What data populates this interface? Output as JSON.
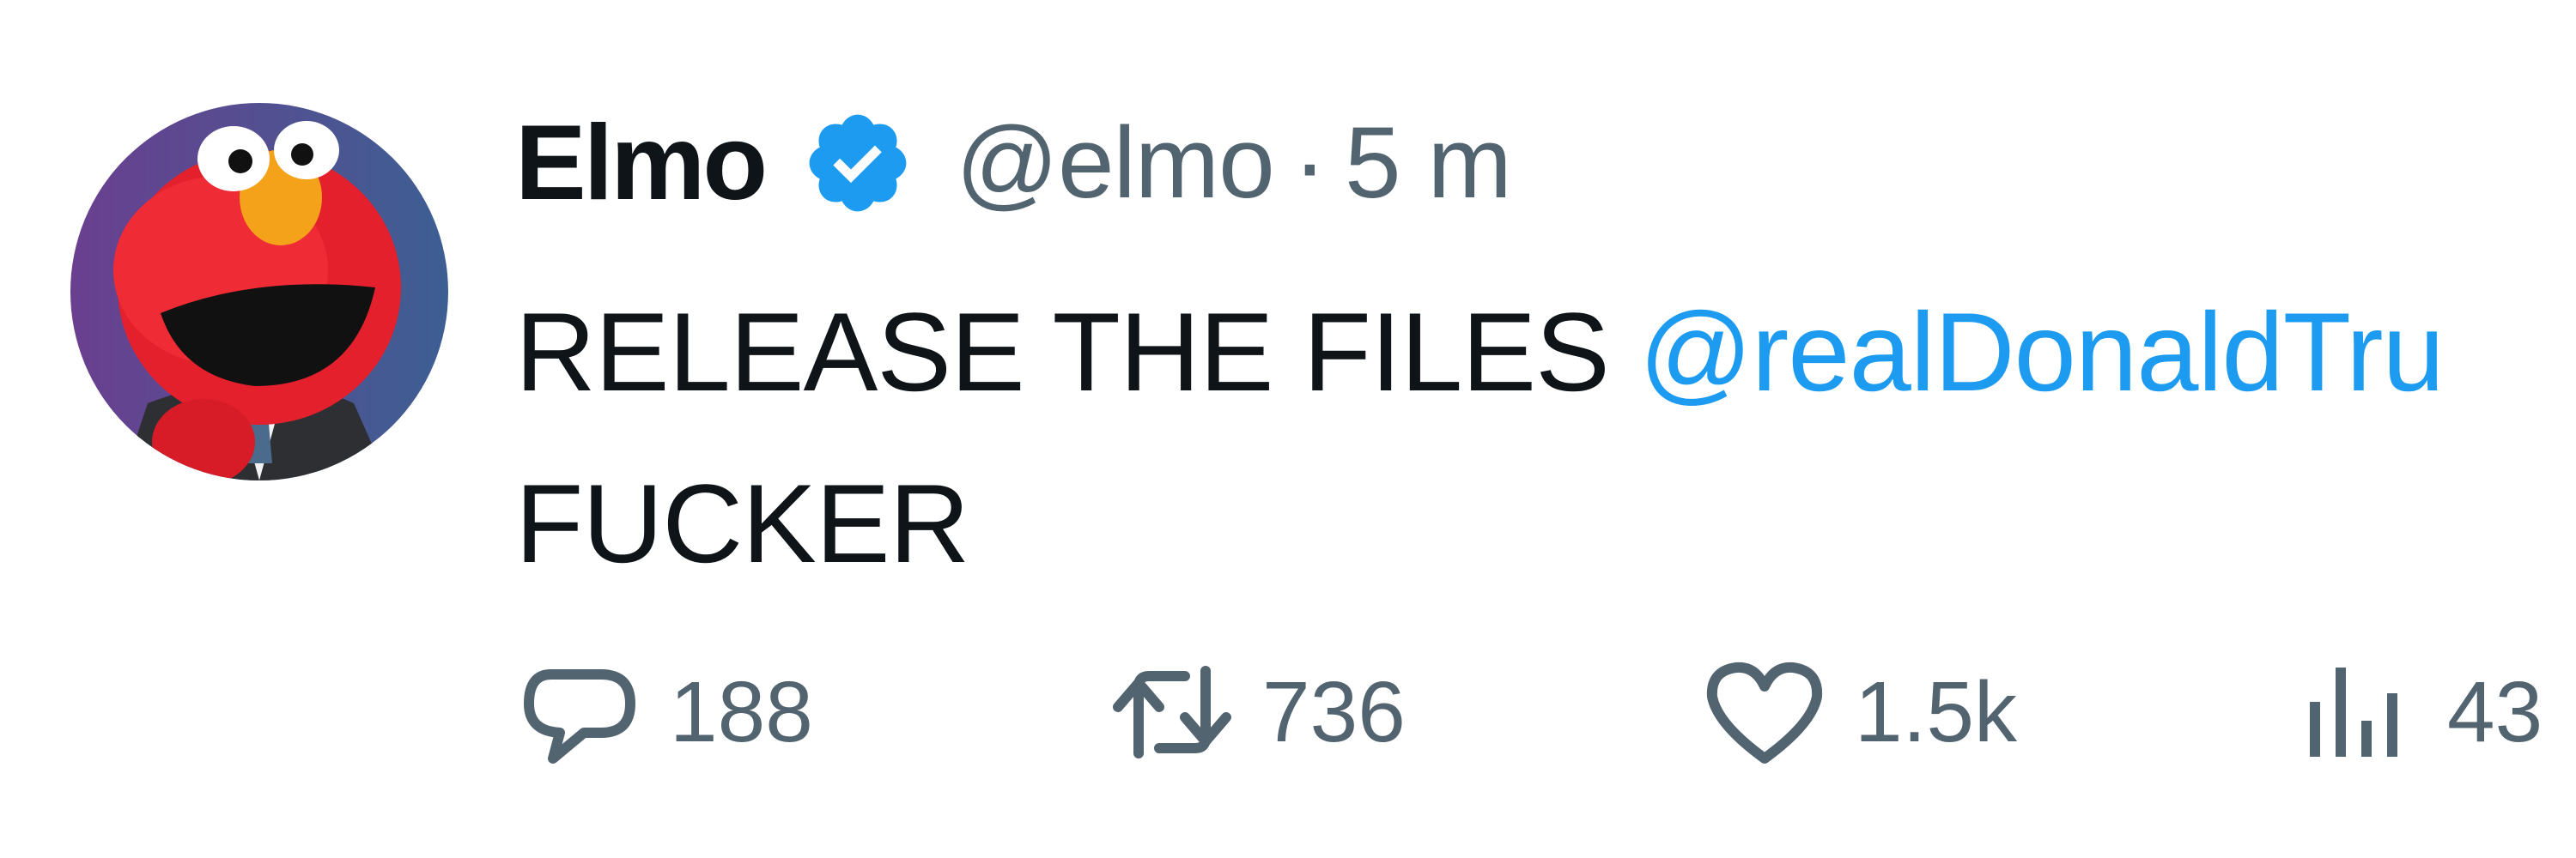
{
  "tweet": {
    "display_name": "Elmo",
    "handle": "@elmo",
    "separator": "·",
    "timestamp": "5 m",
    "verified": true,
    "body": {
      "text_before_mention": "RELEASE THE FILES ",
      "mention": "@realDonaldTru",
      "line2": "FUCKER"
    },
    "actions": {
      "replies": "188",
      "retweets": "736",
      "likes": "1.5k",
      "views": "43"
    }
  },
  "icons": {
    "reply": "speech-bubble",
    "retweet": "retweet-arrows",
    "like": "heart",
    "views": "bar-chart",
    "verified": "blue-check-badge"
  },
  "colors": {
    "text_primary": "#0f1419",
    "text_secondary": "#536471",
    "link": "#1d9bf0",
    "verified_badge": "#1d9bf0"
  }
}
